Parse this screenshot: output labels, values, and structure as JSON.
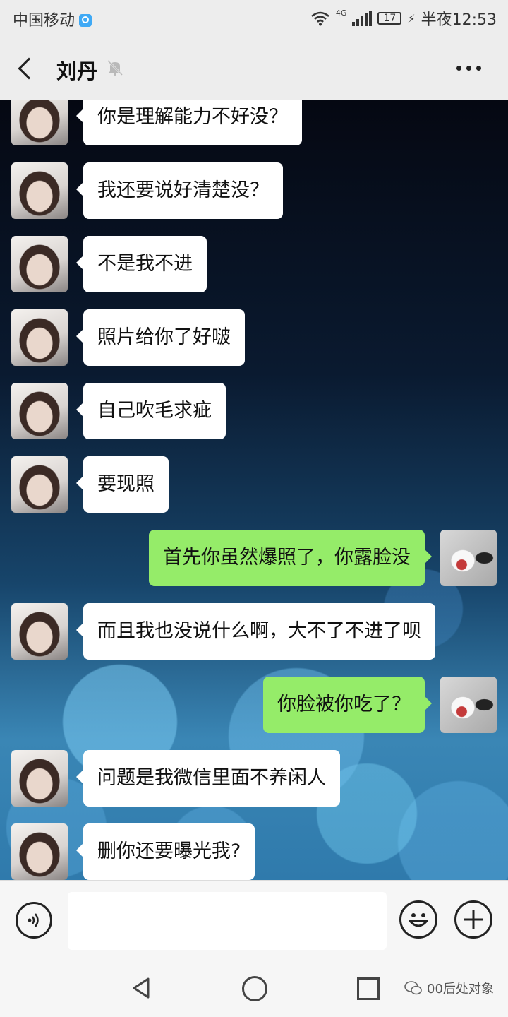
{
  "status_bar": {
    "carrier": "中国移动",
    "network": "4G",
    "battery": "17",
    "time": "半夜12:53"
  },
  "header": {
    "title": "刘丹",
    "icons": [
      "back-icon",
      "mute-bell-icon",
      "more-icon"
    ]
  },
  "messages": [
    {
      "side": "in",
      "text": "你是理解能力不好没？"
    },
    {
      "side": "in",
      "text": "我还要说好清楚没？"
    },
    {
      "side": "in",
      "text": "不是我不进"
    },
    {
      "side": "in",
      "text": "照片给你了好啵"
    },
    {
      "side": "in",
      "text": "自己吹毛求疵"
    },
    {
      "side": "in",
      "text": "要现照"
    },
    {
      "side": "out",
      "text": "首先你虽然爆照了，你露脸没"
    },
    {
      "side": "in",
      "text": "而且我也没说什么啊，大不了不进了呗"
    },
    {
      "side": "out",
      "text": "你脸被你吃了？"
    },
    {
      "side": "in",
      "text": "问题是我微信里面不养闲人"
    },
    {
      "side": "in",
      "text": "删你还要曝光我?"
    }
  ],
  "input_bar": {
    "text_value": "",
    "icons": [
      "voice-icon",
      "emoji-icon",
      "plus-icon"
    ]
  },
  "nav_bar": {
    "watermark": "00后处对象",
    "icons": [
      "nav-back-icon",
      "nav-home-icon",
      "nav-recent-icon"
    ]
  },
  "colors": {
    "incoming_bubble": "#ffffff",
    "outgoing_bubble": "#95ec69",
    "bar_background": "#ededed"
  }
}
